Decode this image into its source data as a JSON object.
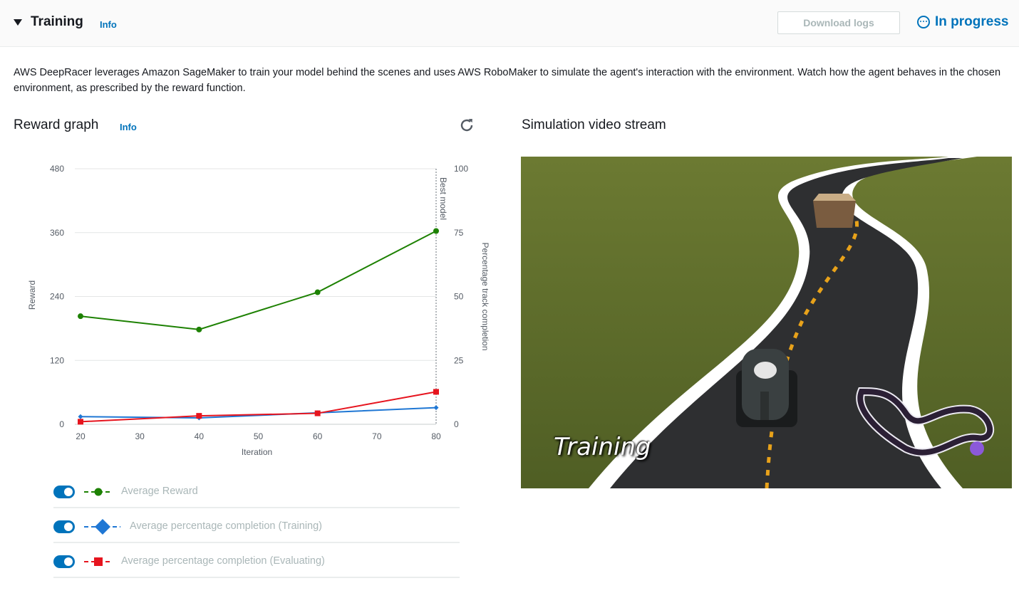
{
  "header": {
    "title": "Training",
    "info": "Info",
    "download_logs": "Download logs",
    "status": "In progress"
  },
  "description": "AWS DeepRacer leverages Amazon SageMaker to train your model behind the scenes and uses AWS RoboMaker to simulate the agent's interaction with the environment. Watch how the agent behaves in the chosen environment, as prescribed by the reward function.",
  "reward_graph": {
    "title": "Reward graph",
    "info": "Info",
    "refresh_icon": "refresh-icon"
  },
  "video": {
    "title": "Simulation video stream",
    "overlay_text": "Training"
  },
  "chart_data": {
    "type": "line",
    "x": [
      20,
      40,
      60,
      80
    ],
    "xlabel": "Iteration",
    "xticks": [
      "20",
      "30",
      "40",
      "50",
      "60",
      "70",
      "80"
    ],
    "xlim": [
      20,
      80
    ],
    "ylabel": "Reward",
    "ylim": [
      0,
      480
    ],
    "yticks": [
      "0",
      "120",
      "240",
      "360",
      "480"
    ],
    "y2label": "Percentage track completion",
    "y2lim": [
      0,
      100
    ],
    "y2ticks": [
      "0",
      "25",
      "50",
      "75",
      "100"
    ],
    "annotation": "Best model",
    "annotation_x": 80,
    "grid": true,
    "series": [
      {
        "name": "Average Reward",
        "axis": "left",
        "color": "#1d8102",
        "marker": "circle",
        "values": [
          203,
          178,
          248,
          363
        ]
      },
      {
        "name": "Average percentage completion (Training)",
        "axis": "right",
        "color": "#1f77d4",
        "marker": "diamond",
        "values": [
          3.0,
          2.5,
          4.5,
          6.5
        ]
      },
      {
        "name": "Average percentage completion (Evaluating)",
        "axis": "right",
        "color": "#e6141e",
        "marker": "square",
        "values": [
          1.0,
          3.3,
          4.3,
          12.7
        ]
      }
    ]
  },
  "legend": [
    {
      "label": "Average Reward",
      "color": "#1d8102",
      "marker": "circle"
    },
    {
      "label": "Average percentage completion (Training)",
      "color": "#1f77d4",
      "marker": "diamond"
    },
    {
      "label": "Average percentage completion (Evaluating)",
      "color": "#e6141e",
      "marker": "square"
    }
  ]
}
